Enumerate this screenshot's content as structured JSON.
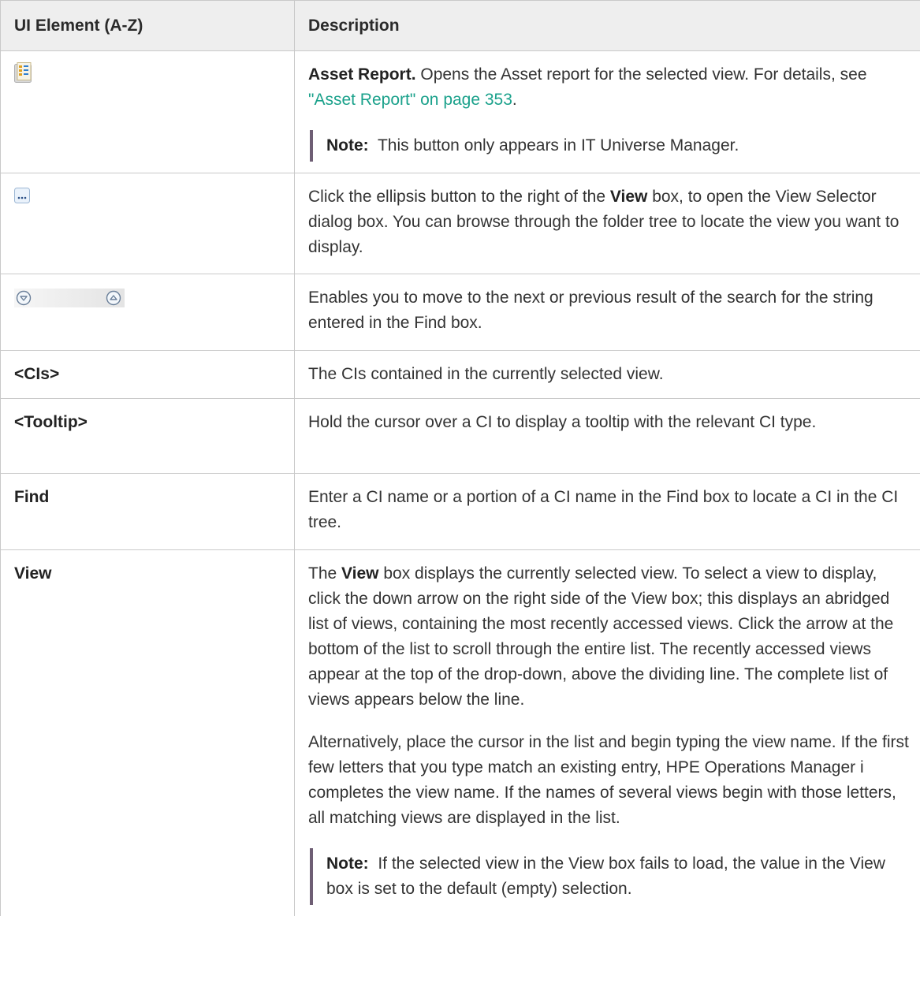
{
  "header": {
    "col1": "UI Element (A-Z)",
    "col2": "Description"
  },
  "rows": [
    {
      "icon": "asset-report-icon",
      "desc_bold": "Asset Report.",
      "desc_text": " Opens the Asset report for the selected view. For details, see ",
      "desc_link": "\"Asset Report\" on page 353",
      "desc_end": ".",
      "note_label": "Note:",
      "note_text": "  This button only appears in IT Universe Manager."
    },
    {
      "icon": "ellipsis-icon",
      "desc_a": "Click the ellipsis button to the right of the ",
      "desc_bold": "View",
      "desc_b": " box, to open the View Selector dialog box. You can browse through the folder tree to locate the view you want to display."
    },
    {
      "icons": [
        "next-result-icon",
        "previous-result-icon"
      ],
      "desc": "Enables you to move to the next or previous result of the search for the string entered in the Find box."
    },
    {
      "element": "<CIs>",
      "desc": "The CIs contained in the currently selected view."
    },
    {
      "element": "<Tooltip>",
      "desc": "Hold the cursor over a CI to display a tooltip with the relevant CI type."
    },
    {
      "element": "Find",
      "desc": "Enter a CI name or a portion of a CI name in the Find box to locate a CI in the CI tree."
    },
    {
      "element": "View",
      "p1_a": "The ",
      "p1_bold": "View",
      "p1_b": " box displays the currently selected view. To select a view to display, click the down arrow on the right side of the View box; this displays an abridged list of views, containing the most recently accessed views. Click the arrow at the bottom of the list to scroll through the entire list. The recently accessed views appear at the top of the drop-down, above the dividing line. The complete list of views appears below the line.",
      "p2": "Alternatively, place the cursor in the list and begin typing the view name. If the first few letters that you type match an existing entry, HPE Operations Manager i completes the view name. If the names of several views begin with those letters, all matching views are displayed in the list.",
      "note_label": "Note:",
      "note_text": "  If the selected view in the View box fails to load, the value in the View box is set to the default (empty) selection."
    }
  ]
}
